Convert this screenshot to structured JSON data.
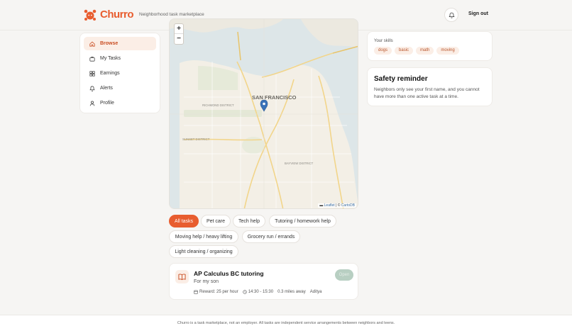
{
  "brand": {
    "name": "Churro",
    "tagline": "Neighborhood task marketplace",
    "accent": "#e85d2f"
  },
  "header": {
    "signout_label": "Sign out",
    "bell_icon": "bell-icon"
  },
  "sidebar": {
    "items": [
      {
        "label": "Browse",
        "icon": "home-icon",
        "active": true
      },
      {
        "label": "My Tasks",
        "icon": "briefcase-icon"
      },
      {
        "label": "Earnings",
        "icon": "grid-icon"
      },
      {
        "label": "Alerts",
        "icon": "bell-icon"
      },
      {
        "label": "Profile",
        "icon": "user-icon"
      }
    ]
  },
  "map": {
    "zoom_in": "+",
    "zoom_out": "−",
    "city_label": "SAN FRANCISCO",
    "districts": [
      "RICHMOND DISTRICT",
      "SUNSET DISTRICT",
      "BAYVIEW DISTRICT"
    ],
    "attribution_leaflet": "Leaflet",
    "attribution_sep": " | © ",
    "attribution_carto": "CartoDB"
  },
  "filters": [
    "All tasks",
    "Pet care",
    "Tech help",
    "Tutoring / homework help",
    "Moving help / heavy lifting",
    "Grocery run / errands",
    "Light cleaning / organizing"
  ],
  "task": {
    "title": "AP Calculus BC tutoring",
    "subtitle": "For my son",
    "reward": "Reward: 25 per hour",
    "time": "14:30 - 15:30",
    "distance": "0.3 miles away",
    "poster": "Aditya",
    "status": "Open"
  },
  "skills": {
    "label": "Your skills",
    "items": [
      "dogs",
      "basic",
      "math",
      "moving"
    ]
  },
  "safety": {
    "title": "Safety reminder",
    "text": "Neighbors only see your first name, and you cannot have more than one active task at a time."
  },
  "footer": {
    "text": "Churro is a task marketplace, not an employer. All tasks are independent service arrangements between neighbors and teens."
  }
}
